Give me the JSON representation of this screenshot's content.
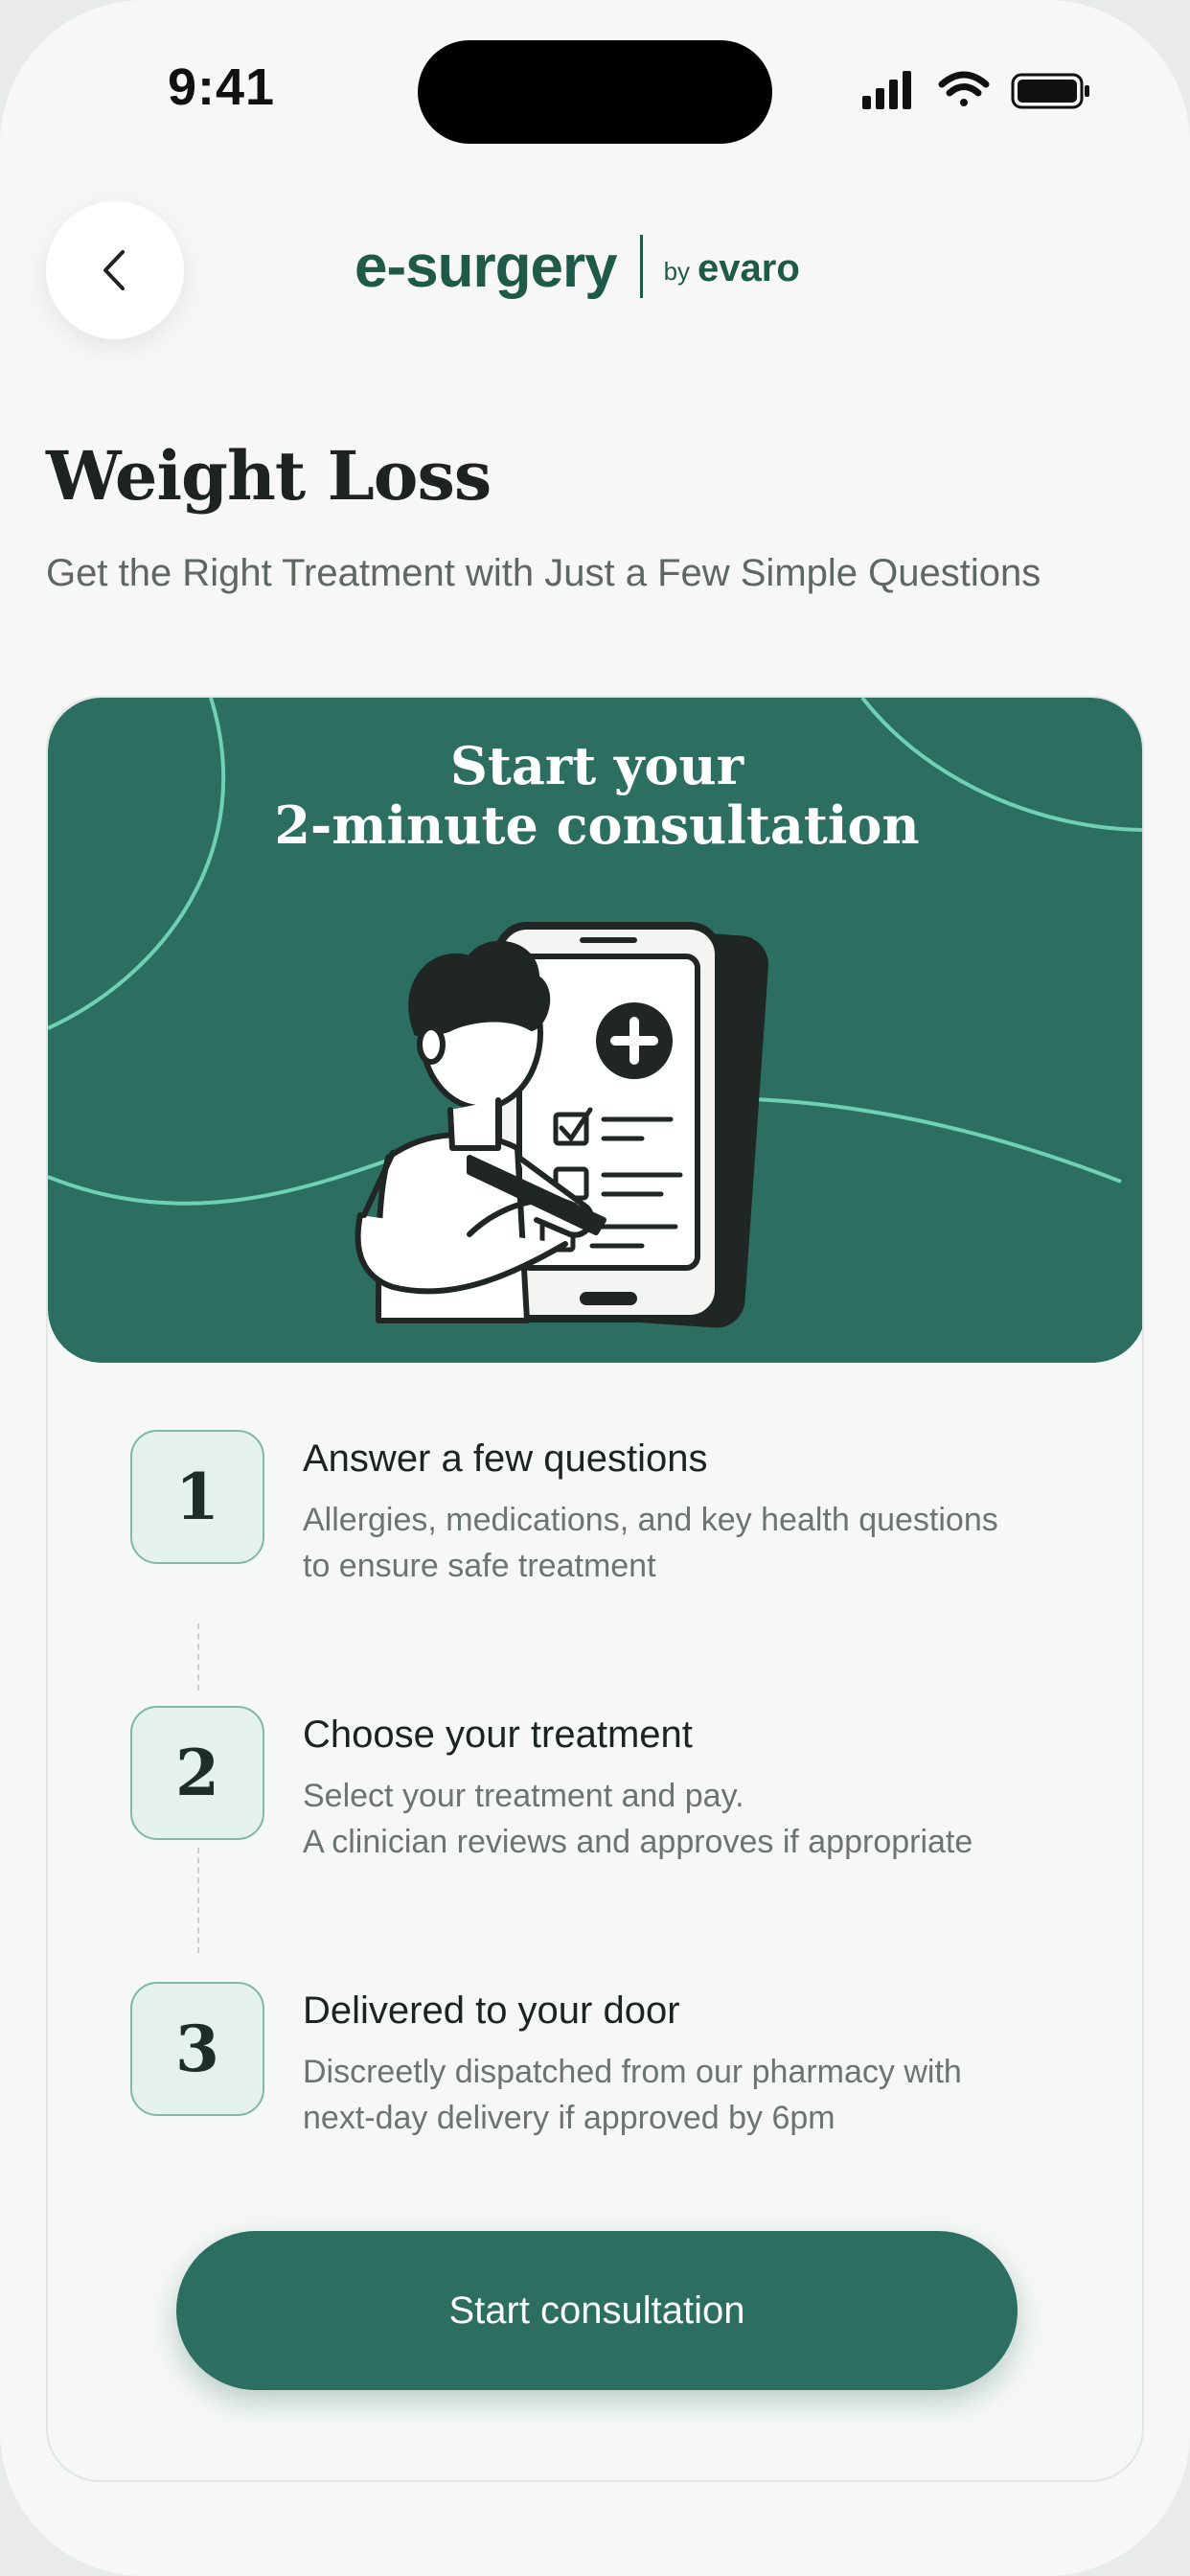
{
  "status_bar": {
    "time": "9:41"
  },
  "header": {
    "logo_main": "e-surgery",
    "logo_by": "by",
    "logo_sub": "evaro"
  },
  "page": {
    "title": "Weight Loss",
    "subtitle": "Get the Right Treatment with Just a Few Simple Questions"
  },
  "hero": {
    "title_line1": "Start your",
    "title_line2": "2-minute consultation"
  },
  "steps": [
    {
      "number": "1",
      "title": "Answer a few questions",
      "desc_line1": "Allergies, medications, and key health questions",
      "desc_line2": "to ensure safe treatment"
    },
    {
      "number": "2",
      "title": "Choose your treatment",
      "desc_line1": "Select your treatment and pay.",
      "desc_line2": "A clinician reviews and approves if appropriate"
    },
    {
      "number": "3",
      "title": "Delivered to your door",
      "desc_line1": "Discreetly dispatched from our pharmacy with",
      "desc_line2": "next-day delivery if approved by 6pm"
    }
  ],
  "cta": {
    "label": "Start consultation"
  },
  "colors": {
    "brand": "#2c6e5f",
    "brand_dark": "#1f5a48",
    "accent_line": "#6fd1b4"
  }
}
